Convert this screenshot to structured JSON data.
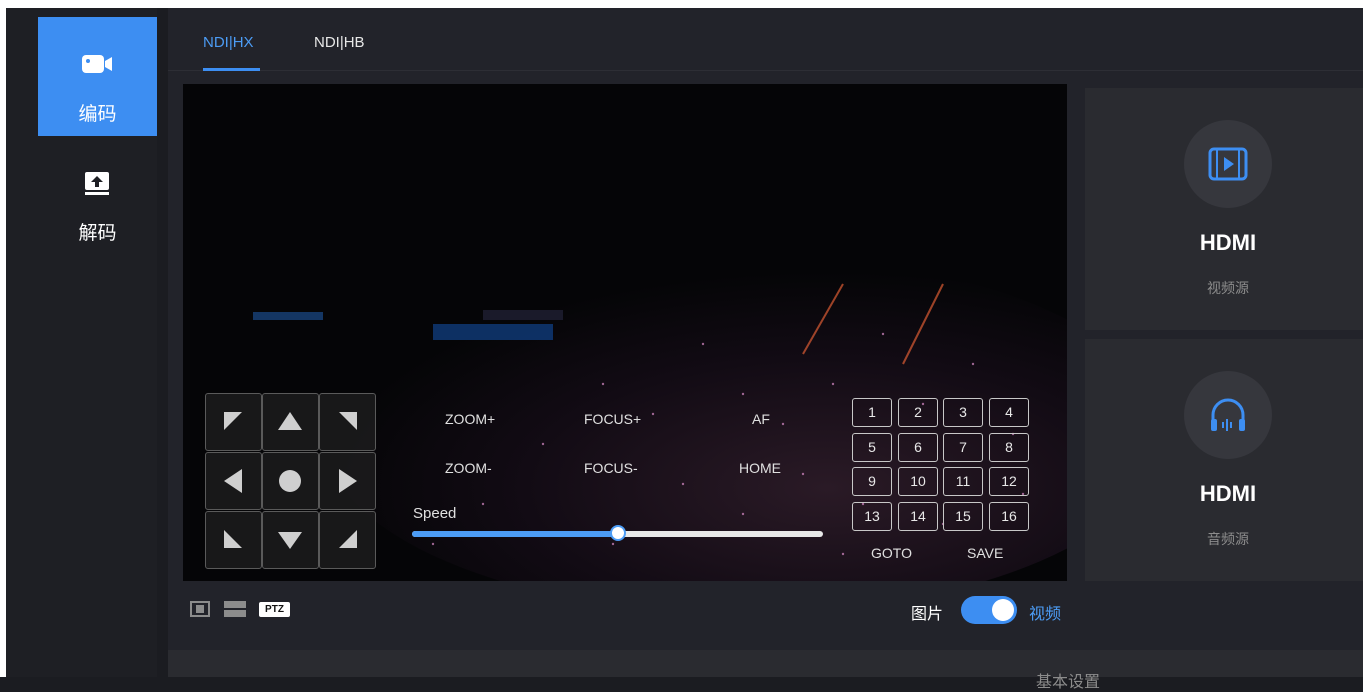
{
  "sidebar": {
    "items": [
      {
        "label": "编码",
        "icon": "video-camera-icon",
        "active": true
      },
      {
        "label": "解码",
        "icon": "upload-screen-icon",
        "active": false
      }
    ]
  },
  "tabs": [
    {
      "label": "NDI|HX",
      "active": true
    },
    {
      "label": "NDI|HB",
      "active": false
    }
  ],
  "ptz": {
    "controls": {
      "zoom_in": "ZOOM+",
      "zoom_out": "ZOOM-",
      "focus_in": "FOCUS+",
      "focus_out": "FOCUS-",
      "af": "AF",
      "home": "HOME"
    },
    "speed_label": "Speed",
    "speed_value": 0.5,
    "presets": [
      "1",
      "2",
      "3",
      "4",
      "5",
      "6",
      "7",
      "8",
      "9",
      "10",
      "11",
      "12",
      "13",
      "14",
      "15",
      "16"
    ],
    "goto_label": "GOTO",
    "save_label": "SAVE"
  },
  "sources": [
    {
      "title": "HDMI",
      "subtitle": "视频源",
      "icon": "video-play-icon"
    },
    {
      "title": "HDMI",
      "subtitle": "音频源",
      "icon": "headphones-icon"
    }
  ],
  "bottombar": {
    "ptz_badge": "PTZ",
    "toggle_left": "图片",
    "toggle_right": "视频",
    "toggle_on": true
  },
  "lower_section": {
    "title": "基本设置"
  },
  "colors": {
    "accent": "#3d8ef2",
    "background": "#1b1c21",
    "panel": "#2a2b30"
  }
}
